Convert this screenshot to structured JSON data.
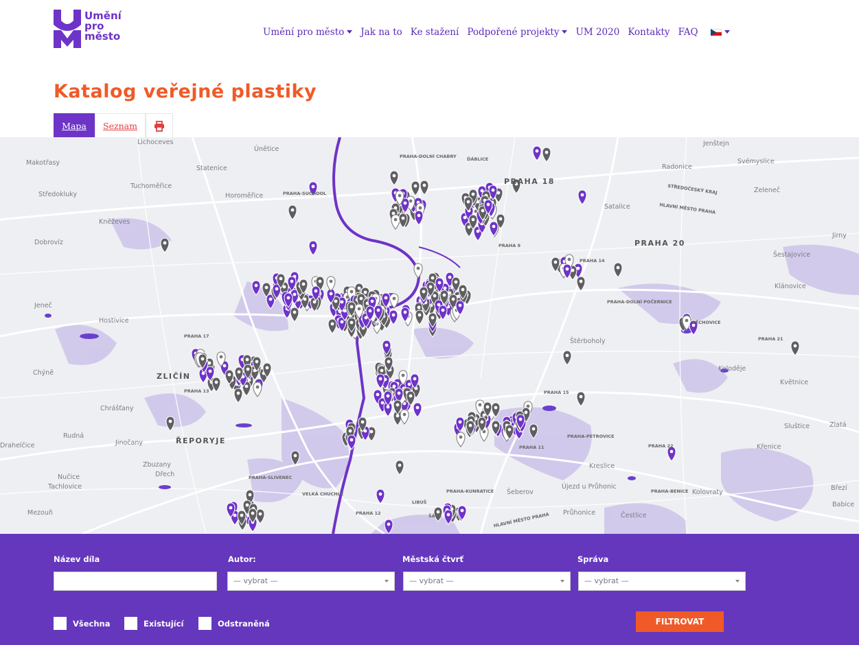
{
  "logo": {
    "line1": "Umění",
    "line2": "pro",
    "line3": "město"
  },
  "nav": {
    "items": [
      {
        "label": "Umění pro město",
        "dropdown": true
      },
      {
        "label": "Jak na to",
        "dropdown": false
      },
      {
        "label": "Ke stažení",
        "dropdown": false
      },
      {
        "label": "Podpořené projekty",
        "dropdown": true
      },
      {
        "label": "UM 2020",
        "dropdown": false
      },
      {
        "label": "Kontakty",
        "dropdown": false
      },
      {
        "label": "FAQ",
        "dropdown": false
      }
    ],
    "language_icon": "czech-flag-icon"
  },
  "page": {
    "title": "Katalog veřejné plastiky"
  },
  "tabs": {
    "map": "Mapa",
    "list": "Seznam",
    "print_icon": "print-icon"
  },
  "map": {
    "labels": {
      "districts": [
        "PRAHA 18",
        "PRAHA 20",
        "ZLIČÍN",
        "ŘEPORYJE"
      ],
      "towns": [
        "Lichoceves",
        "Únětice",
        "Makotřasy",
        "Statenice",
        "Tuchoměřice",
        "Středokluky",
        "Horoměřice",
        "Kněževes",
        "Dobrovíz",
        "Jeneč",
        "Hostivice",
        "Chýně",
        "Chrášťany",
        "Rudná",
        "Jinočany",
        "Zbuzany",
        "Dřech",
        "Nučice",
        "Tachlovice",
        "Mezouň",
        "Drahelčice",
        "Jenštejn",
        "Radonice",
        "Svémyslice",
        "Zeleneč",
        "Satalice",
        "Šestajovice",
        "Jirny",
        "Klánovice",
        "Štěrboholy",
        "Koloděje",
        "Květnice",
        "Sluštice",
        "Zlatá",
        "Křenice",
        "Kreslice",
        "Šeberov",
        "Újezd u Průhonic",
        "Průhonice",
        "Čestlice",
        "Kolovraty",
        "Březí",
        "Babice"
      ],
      "small": [
        "PRAHA-DOLNÍ CHABRY",
        "ĎÁBLICE",
        "STŘEDOČESKÝ KRAJ",
        "HLAVNÍ MĚSTO PRAHA",
        "PRAHA-DOLNÍ POČERNICE",
        "PRAHA 21",
        "PRAHA 22",
        "PRAHA-PETROVICE",
        "PRAHA-BENICE",
        "PRAHA-KUNRATICE",
        "PRAHA 12",
        "PRAHA-SLIVENEC",
        "VELKÁ CHUCHLE",
        "LIBUŠ",
        "ŠÁPA",
        "PRAHA 13",
        "PRAHA 17",
        "PRAHA-SUCHDOL",
        "PRAHA 9",
        "PRAHA 15",
        "PRAHA 11",
        "PRAHA 14",
        "BĚCHOVICE",
        "HLAVNÍ MĚSTO PRAHA"
      ]
    },
    "colors": {
      "primary": "#6e33c7",
      "marker_gray": "#5f5f63",
      "marker_white": "#ffffff",
      "water": "#6a3fcf",
      "forest": "#cbbfe8",
      "river": "#6e33c7"
    }
  },
  "filter": {
    "name_label": "Název díla",
    "author_label": "Autor:",
    "district_label": "Městská čtvrť",
    "admin_label": "Správa",
    "select_placeholder": "— vybrat —",
    "checks": [
      "Všechna",
      "Existující",
      "Odstraněná"
    ],
    "submit": "FILTROVAT"
  }
}
